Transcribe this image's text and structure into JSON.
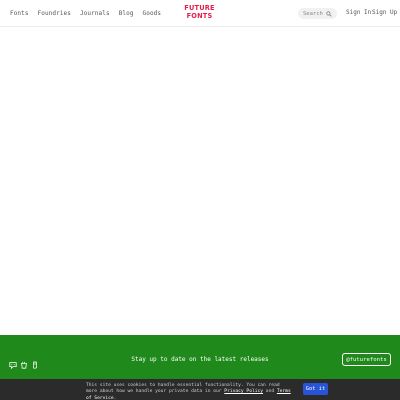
{
  "header": {
    "nav": [
      "Fonts",
      "Foundries",
      "Journals",
      "Blog",
      "Goods"
    ],
    "logo_lines": [
      "FUTURE",
      "FONTS"
    ],
    "search_placeholder": "Search",
    "sign_in": "Sign In",
    "sign_up": "Sign Up"
  },
  "footer": {
    "newsletter_text": "Stay up to date on the latest releases",
    "social_handle": "@futurefonts",
    "icons": [
      "chat-icon",
      "cup-icon",
      "hand-icon"
    ]
  },
  "cookie": {
    "text_before": "This site uses cookies to handle essential functionality. You can read more about how we handle your private data in our ",
    "privacy_link": "Privacy Policy",
    "text_and": " and ",
    "terms_link": "Terms of Service",
    "text_after": ".",
    "button_label": "Got it"
  },
  "colors": {
    "accent_red": "#e3204a",
    "footer_green": "#1f8a1b",
    "cookie_bg": "#2b2b2b",
    "button_blue": "#2855d8"
  }
}
